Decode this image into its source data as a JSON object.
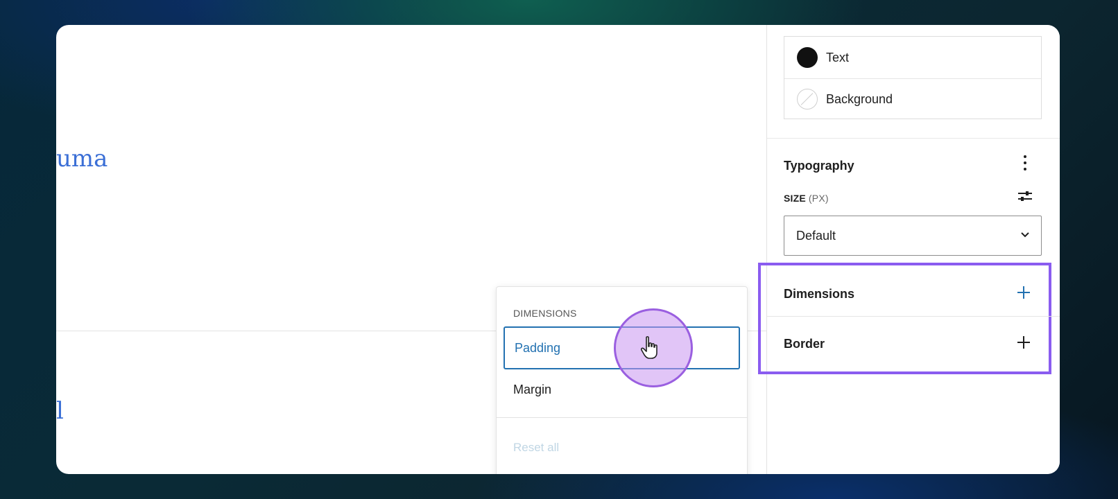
{
  "editor": {
    "fragment_top": "uma",
    "fragment_bottom": "l"
  },
  "popover": {
    "heading": "DIMENSIONS",
    "items": [
      "Padding",
      "Margin"
    ],
    "reset": "Reset all"
  },
  "sidebar": {
    "colors": [
      {
        "label": "Text",
        "swatch": "#111111"
      },
      {
        "label": "Background",
        "swatch": "none"
      }
    ],
    "typography": {
      "title": "Typography",
      "size_label": "SIZE",
      "size_unit": "(PX)",
      "size_value": "Default"
    },
    "panels": {
      "dimensions": "Dimensions",
      "border": "Border"
    }
  },
  "colors": {
    "accent": "#2271b1",
    "highlight": "#8a5cf0",
    "link": "#3b6fd6"
  }
}
